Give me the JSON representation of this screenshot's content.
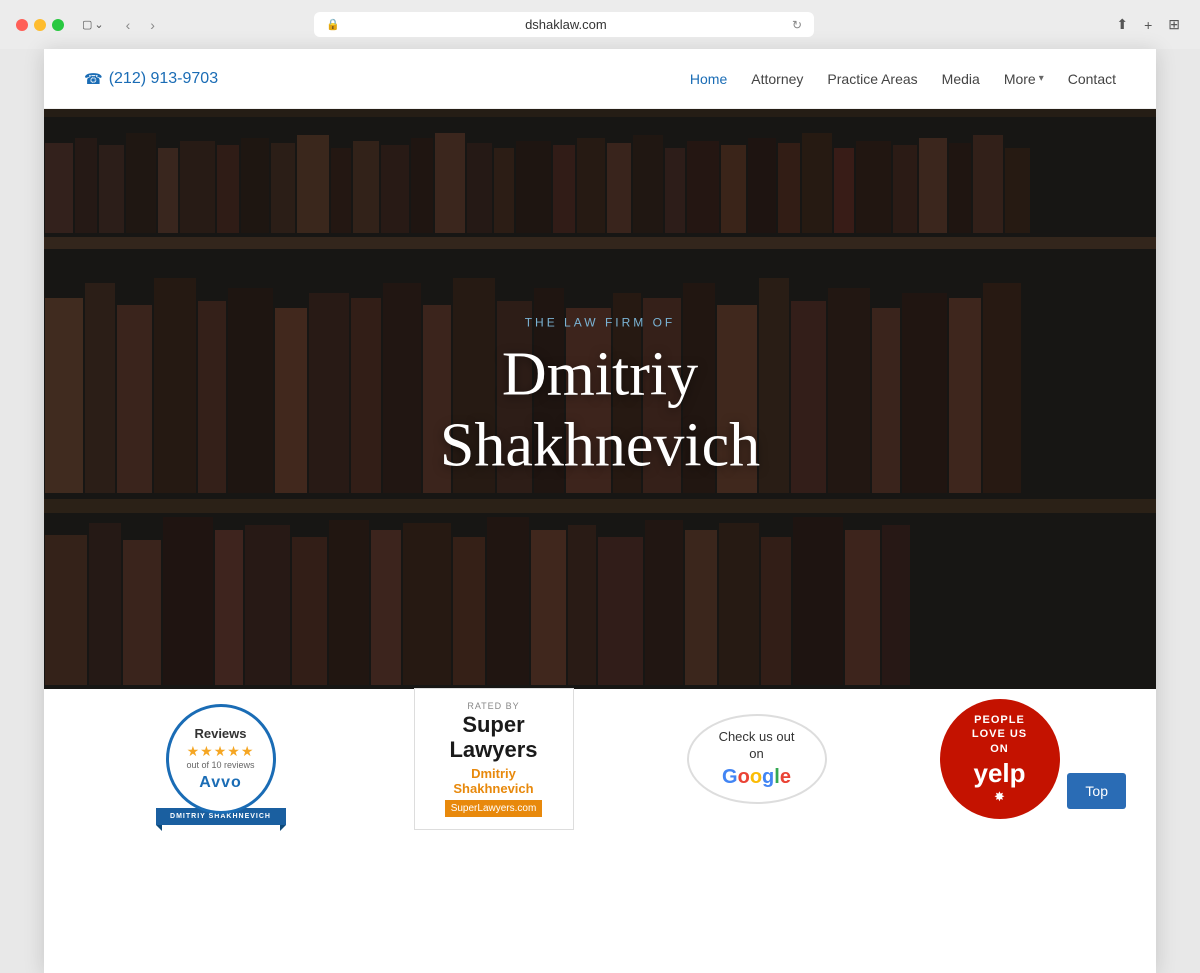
{
  "browser": {
    "url": "dshaklaw.com",
    "dots": [
      "red",
      "yellow",
      "green"
    ],
    "back_label": "‹",
    "forward_label": "›",
    "refresh_label": "↻",
    "share_label": "⬆",
    "new_tab_label": "+",
    "grid_label": "⊞"
  },
  "header": {
    "phone": "(212) 913-9703",
    "phone_icon": "☎",
    "nav_items": [
      {
        "label": "Home",
        "active": true
      },
      {
        "label": "Attorney",
        "active": false
      },
      {
        "label": "Practice Areas",
        "active": false
      },
      {
        "label": "Media",
        "active": false
      },
      {
        "label": "More",
        "has_dropdown": true,
        "active": false
      },
      {
        "label": "Contact",
        "active": false
      }
    ]
  },
  "hero": {
    "subtitle": "THE LAW FIRM OF",
    "title_line1": "Dmitriy",
    "title_line2": "Shakhnevich"
  },
  "badges": {
    "avvo": {
      "reviews_label": "Reviews",
      "stars": "★★★★★",
      "count": "out of 10 reviews",
      "name": "DMITRIY SHAKHNEVICH",
      "logo": "Avvo"
    },
    "super_lawyers": {
      "rated_by": "RATED BY",
      "title": "Super Lawyers",
      "name": "Dmitriy\nShakhnevich",
      "site": "SuperLawyers.com"
    },
    "google": {
      "line1": "Check us out",
      "line2": "on",
      "logo_letters": [
        "G",
        "o",
        "o",
        "g",
        "l",
        "e"
      ]
    },
    "yelp": {
      "line1": "PEOPLE",
      "line2": "LOVE US",
      "line3": "ON",
      "logo": "yelp"
    }
  },
  "top_button": {
    "label": "Top"
  }
}
